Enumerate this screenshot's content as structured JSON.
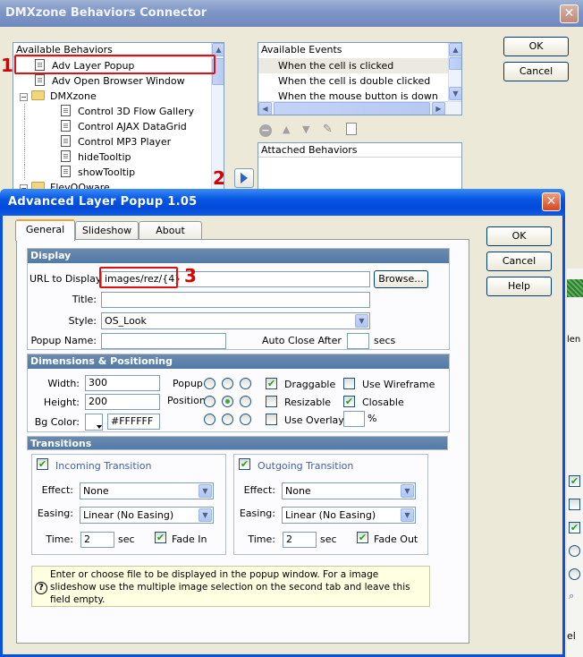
{
  "back_window": {
    "title": "DMXzone Behaviors Connector",
    "behaviors_header": "Available Behaviors",
    "behaviors": [
      "Adv Layer Popup",
      "Adv Open Browser Window",
      "DMXzone",
      "Control 3D Flow Gallery",
      "Control AJAX DataGrid",
      "Control MP3 Player",
      "hideTooltip",
      "showTooltip",
      "FlevOOware"
    ],
    "events_header": "Available Events",
    "events": [
      "When the cell is clicked",
      "When the cell is double clicked",
      "When the mouse button is down"
    ],
    "attached_header": "Attached Behaviors",
    "ok_label": "OK",
    "cancel_label": "Cancel",
    "right_partial_text": [
      "len",
      "el"
    ]
  },
  "annotations": {
    "step1": "1",
    "step2": "2",
    "step3": "3"
  },
  "front_window": {
    "title": "Advanced Layer Popup 1.05",
    "tabs": [
      "General",
      "Slideshow",
      "About"
    ],
    "ok_label": "OK",
    "cancel_label": "Cancel",
    "help_label": "Help",
    "display": {
      "header": "Display",
      "url_label": "URL to Display:",
      "url_value": "images/rez/{4}",
      "browse_label": "Browse...",
      "title_label": "Title:",
      "title_value": "",
      "style_label": "Style:",
      "style_value": "OS_Look",
      "popup_name_label": "Popup Name:",
      "popup_name_value": "",
      "auto_close_label": "Auto Close After",
      "auto_close_value": "",
      "auto_close_unit": "secs"
    },
    "dimensions": {
      "header": "Dimensions & Positioning",
      "width_label": "Width:",
      "width_value": "300",
      "height_label": "Height:",
      "height_value": "200",
      "bgcolor_label": "Bg Color:",
      "bgcolor_value": "#FFFFFF",
      "popup_position_label": "Popup",
      "position_label": "Position",
      "selected_position": "center",
      "draggable_label": "Draggable",
      "draggable_checked": true,
      "resizable_label": "Resizable",
      "resizable_checked": false,
      "use_overlay_label": "Use Overlay",
      "use_overlay_checked": false,
      "use_wireframe_label": "Use Wireframe",
      "use_wireframe_checked": false,
      "closable_label": "Closable",
      "closable_checked": true,
      "overlay_value": "",
      "overlay_unit": "%"
    },
    "transitions": {
      "header": "Transitions",
      "incoming_label": "Incoming Transition",
      "incoming_checked": true,
      "outgoing_label": "Outgoing Transition",
      "outgoing_checked": true,
      "effect_label": "Effect:",
      "easing_label": "Easing:",
      "time_label": "Time:",
      "sec_label": "sec",
      "incoming_effect": "None",
      "incoming_easing": "Linear (No Easing)",
      "incoming_time": "2",
      "fade_in_label": "Fade In",
      "fade_in_checked": true,
      "outgoing_effect": "None",
      "outgoing_easing": "Linear (No Easing)",
      "outgoing_time": "2",
      "fade_out_label": "Fade Out",
      "fade_out_checked": true
    },
    "hint_text": "Enter or choose file to be displayed in the popup window. For a image slideshow use the multiple image selection on the second tab and leave this field empty."
  },
  "colors": {
    "annotation_red": "#e01010",
    "xp_blue_title": "#0555e3",
    "section_header": "#5f83ad"
  }
}
